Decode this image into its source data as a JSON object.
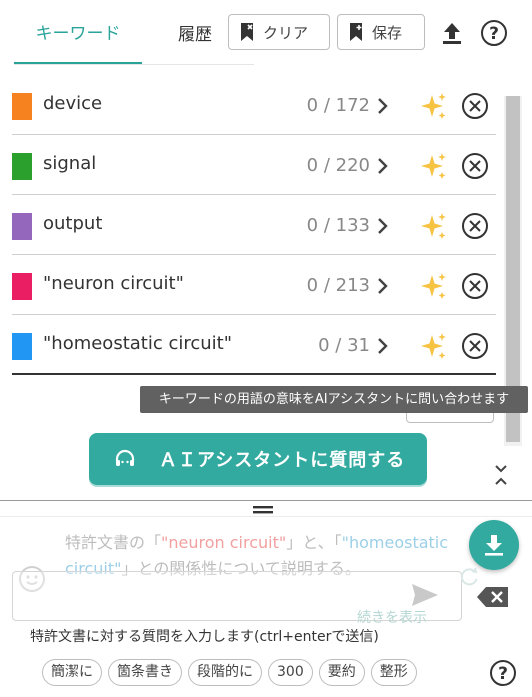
{
  "header": {
    "tab_keywords": "キーワード",
    "tab_history": "履歴",
    "clear_label": "クリア",
    "save_label": "保存"
  },
  "keywords": [
    {
      "label": "device",
      "count": "0 / 172",
      "color": "#f5821f"
    },
    {
      "label": "signal",
      "count": "0 / 220",
      "color": "#2ca02c"
    },
    {
      "label": "output",
      "count": "0 / 133",
      "color": "#9467bd"
    },
    {
      "label": "\"neuron circuit\"",
      "count": "0 / 213",
      "color": "#e91e63"
    },
    {
      "label": "\"homeostatic circuit\"",
      "count": "0 / 31",
      "color": "#2196f3"
    }
  ],
  "tooltip": "キーワードの用語の意味をAIアシスタントに問い合わせます",
  "ai_button_label": "ＡＩアシスタントに質問する",
  "question": {
    "part1": "特許文書の「",
    "kw1": "\"neuron circuit\"",
    "part2": "」と、「",
    "kw2": "\"homeostatic circuit\"",
    "part3": "」との関係性について説明する。"
  },
  "show_more": "続きを表示",
  "input_hint": "特許文書に対する質問を入力します(ctrl+enterで送信)",
  "chips": [
    "簡潔に",
    "箇条書き",
    "段階的に",
    "300",
    "要約",
    "整形"
  ],
  "colors": {
    "accent": "#33aaa0",
    "tooltip_bg": "#616161"
  }
}
